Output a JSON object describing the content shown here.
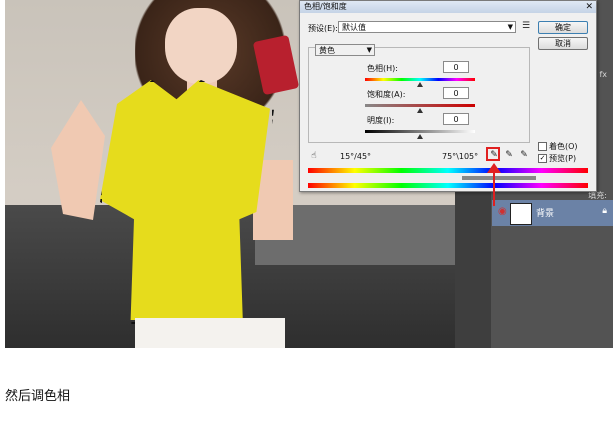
{
  "dialog": {
    "title": "色相/饱和度",
    "close": "✕",
    "preset_label": "预设(E):",
    "preset_value": "默认值",
    "ok": "确定",
    "cancel": "取消",
    "channel": "黄色",
    "hue_label": "色相(H):",
    "hue_value": "0",
    "sat_label": "饱和度(A):",
    "sat_value": "0",
    "light_label": "明度(I):",
    "light_value": "0",
    "range_left": "15°/45°",
    "range_right": "75°\\105°",
    "colorize_label": "着色(O)",
    "preview_label": "预览(P)",
    "preview_checked": true,
    "colorize_checked": false
  },
  "layers": {
    "layer_name": "背景",
    "labels": [
      "fx",
      "填充:"
    ]
  },
  "caption": "然后调色相"
}
